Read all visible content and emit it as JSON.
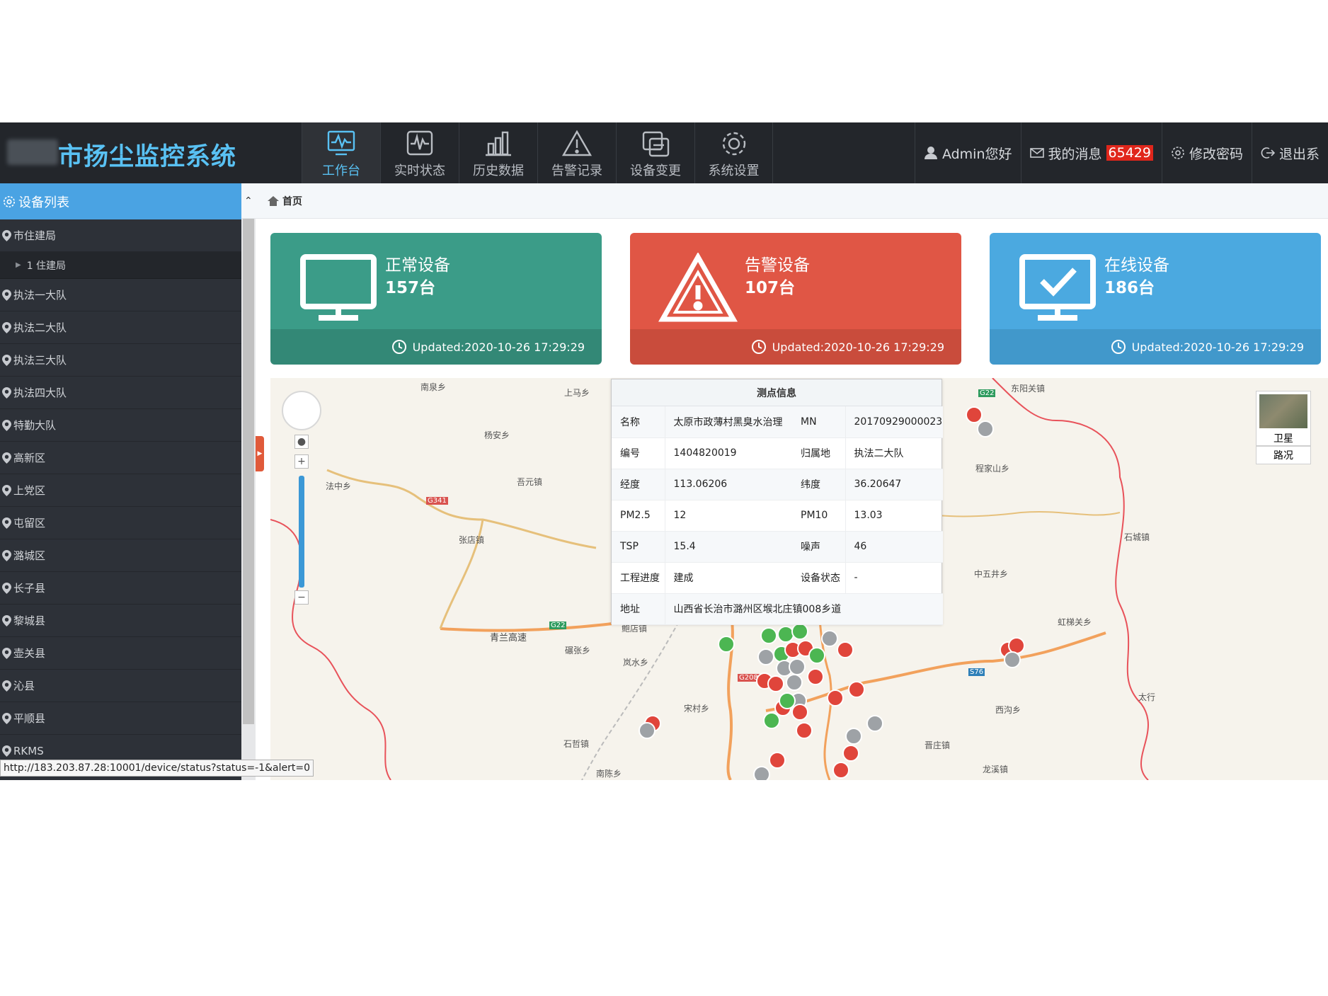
{
  "app": {
    "title_text": "市扬尘监控系统"
  },
  "nav": [
    {
      "label": "工作台",
      "icon": "dashboard-icon",
      "active": true
    },
    {
      "label": "实时状态",
      "icon": "pulse-icon",
      "active": false
    },
    {
      "label": "历史数据",
      "icon": "bar-chart-icon",
      "active": false
    },
    {
      "label": "告警记录",
      "icon": "warning-icon",
      "active": false
    },
    {
      "label": "设备变更",
      "icon": "device-change-icon",
      "active": false
    },
    {
      "label": "系统设置",
      "icon": "gear-icon",
      "active": false
    }
  ],
  "user": {
    "greeting": "Admin您好",
    "messages_label": "我的消息",
    "messages_count": "65429",
    "change_password": "修改密码",
    "logout": "退出系"
  },
  "sidebar": {
    "header": "设备列表",
    "groups": [
      {
        "label": "市住建局",
        "children": [
          {
            "label": "1  住建局"
          }
        ]
      },
      {
        "label": "执法一大队"
      },
      {
        "label": "执法二大队"
      },
      {
        "label": "执法三大队"
      },
      {
        "label": "执法四大队"
      },
      {
        "label": "特勤大队"
      },
      {
        "label": "高新区"
      },
      {
        "label": "上党区"
      },
      {
        "label": "屯留区"
      },
      {
        "label": "潞城区"
      },
      {
        "label": "长子县"
      },
      {
        "label": "黎城县"
      },
      {
        "label": "壶关县"
      },
      {
        "label": "沁县"
      },
      {
        "label": "平顺县"
      },
      {
        "label": "RKMS"
      }
    ]
  },
  "status_url": "http://183.203.87.28:10001/device/status?status=-1&alert=0",
  "breadcrumb": {
    "home": "首页"
  },
  "cards": [
    {
      "title": "正常设备",
      "count": "157台",
      "updated": "Updated:2020-10-26 17:29:29",
      "color": "#3b9c88",
      "foot_color": "#338876"
    },
    {
      "title": "告警设备",
      "count": "107台",
      "updated": "Updated:2020-10-26 17:29:29",
      "color": "#e05645",
      "foot_color": "#c94c3c"
    },
    {
      "title": "在线设备",
      "count": "186台",
      "updated": "Updated:2020-10-26 17:29:29",
      "color": "#4ba9e0",
      "foot_color": "#4198cb"
    }
  ],
  "map": {
    "map_type_satellite": "卫星",
    "map_type_traffic": "路况",
    "places": [
      "南泉乡",
      "上马乡",
      "杨安乡",
      "法中乡",
      "吾元镇",
      "张店镇",
      "青兰高速",
      "碾张乡",
      "岚水乡",
      "宋村乡",
      "石哲镇",
      "南陈乡",
      "鲍店镇",
      "东阳关镇",
      "程家山乡",
      "石城镇",
      "中五井乡",
      "虹梯关乡",
      "西沟乡",
      "晋庄镇",
      "龙溪镇",
      "太行"
    ],
    "road_labels": [
      "G341",
      "G22",
      "G208",
      "S76",
      "G22"
    ]
  },
  "info_window": {
    "title": "测点信息",
    "rows": [
      {
        "k1": "名称",
        "v1": "太原市政薄村黑臭水治理",
        "k2": "MN",
        "v2": "20170929000023"
      },
      {
        "k1": "编号",
        "v1": "1404820019",
        "k2": "归属地",
        "v2": "执法二大队"
      },
      {
        "k1": "经度",
        "v1": "113.06206",
        "k2": "纬度",
        "v2": "36.20647"
      },
      {
        "k1": "PM2.5",
        "v1": "12",
        "k2": "PM10",
        "v2": "13.03"
      },
      {
        "k1": "TSP",
        "v1": "15.4",
        "k2": "噪声",
        "v2": "46"
      },
      {
        "k1": "工程进度",
        "v1": "建成",
        "k2": "设备状态",
        "v2": "-"
      }
    ],
    "address_key": "地址",
    "address_value": "山西省长治市潞州区堠北庄镇008乡道"
  },
  "colors": {
    "normal": "#4cb652",
    "alert": "#e0453b",
    "offline": "#9ea2a6"
  }
}
